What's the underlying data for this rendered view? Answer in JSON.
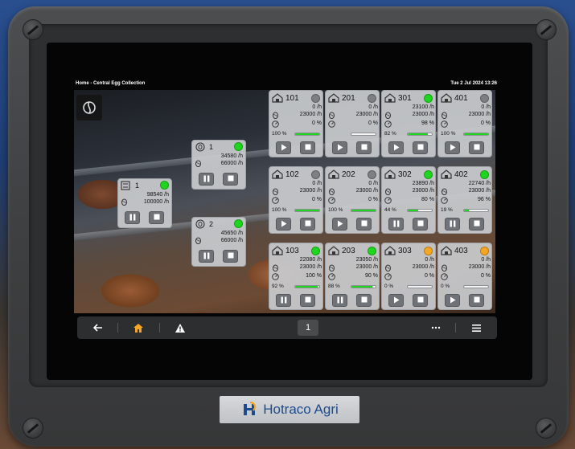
{
  "header": {
    "title": "Home - Central Egg Collection",
    "datetime": "Tue 2 Jul 2024 13:26"
  },
  "colors": {
    "green": "#1ed61e",
    "grey": "#7c7f83",
    "orange": "#f5a623",
    "accent": "#f5a623"
  },
  "stacks": [
    {
      "id": "1",
      "rate": "98540 /h",
      "target": "100000 /h",
      "status": "green",
      "icon": "elevator-icon"
    },
    {
      "id": "1",
      "rate": "34580 /h",
      "target": "66000 /h",
      "status": "green",
      "icon": "egg-hand-icon"
    },
    {
      "id": "2",
      "rate": "45650 /h",
      "target": "66000 /h",
      "status": "green",
      "icon": "egg-hand-icon"
    }
  ],
  "houses": [
    {
      "id": "101",
      "rate": "0 /h",
      "target": "23000 /h",
      "eff": "0 %",
      "speed": "100 %",
      "progress": 100,
      "status": "grey",
      "state": "stopped"
    },
    {
      "id": "201",
      "rate": "0 /h",
      "target": "23000 /h",
      "eff": "0 %",
      "speed": "",
      "progress": 0,
      "status": "grey",
      "state": "stopped"
    },
    {
      "id": "301",
      "rate": "23100 /h",
      "target": "23000 /h",
      "eff": "98 %",
      "speed": "82 %",
      "progress": 82,
      "status": "green",
      "state": "stopped"
    },
    {
      "id": "401",
      "rate": "0 /h",
      "target": "23000 /h",
      "eff": "0 %",
      "speed": "100 %",
      "progress": 100,
      "status": "grey",
      "state": "stopped"
    },
    {
      "id": "102",
      "rate": "0 /h",
      "target": "23000 /h",
      "eff": "0 %",
      "speed": "100 %",
      "progress": 100,
      "status": "grey",
      "state": "stopped"
    },
    {
      "id": "202",
      "rate": "0 /h",
      "target": "23000 /h",
      "eff": "0 %",
      "speed": "100 %",
      "progress": 100,
      "status": "grey",
      "state": "stopped"
    },
    {
      "id": "302",
      "rate": "23890 /h",
      "target": "23000 /h",
      "eff": "80 %",
      "speed": "44 %",
      "progress": 44,
      "status": "green",
      "state": "running"
    },
    {
      "id": "402",
      "rate": "22740 /h",
      "target": "23000 /h",
      "eff": "96 %",
      "speed": "19 %",
      "progress": 19,
      "status": "green",
      "state": "running"
    },
    {
      "id": "103",
      "rate": "22080 /h",
      "target": "23000 /h",
      "eff": "100 %",
      "speed": "92 %",
      "progress": 92,
      "status": "green",
      "state": "running"
    },
    {
      "id": "203",
      "rate": "23050 /h",
      "target": "23000 /h",
      "eff": "90 %",
      "speed": "88 %",
      "progress": 88,
      "status": "green",
      "state": "running"
    },
    {
      "id": "303",
      "rate": "0 /h",
      "target": "23000 /h",
      "eff": "0 %",
      "speed": "0 %",
      "progress": 0,
      "status": "orange",
      "state": "stopped"
    },
    {
      "id": "403",
      "rate": "0 /h",
      "target": "23000 /h",
      "eff": "0 %",
      "speed": "0 %",
      "progress": 0,
      "status": "orange",
      "state": "stopped"
    }
  ],
  "navbar": {
    "page": "1",
    "back_icon": "arrow-left-icon",
    "home_icon": "home-icon",
    "alarm_icon": "warning-icon",
    "more_icon": "ellipsis-icon",
    "menu_icon": "hamburger-icon"
  },
  "brand": {
    "name": "Hotraco Agri"
  }
}
